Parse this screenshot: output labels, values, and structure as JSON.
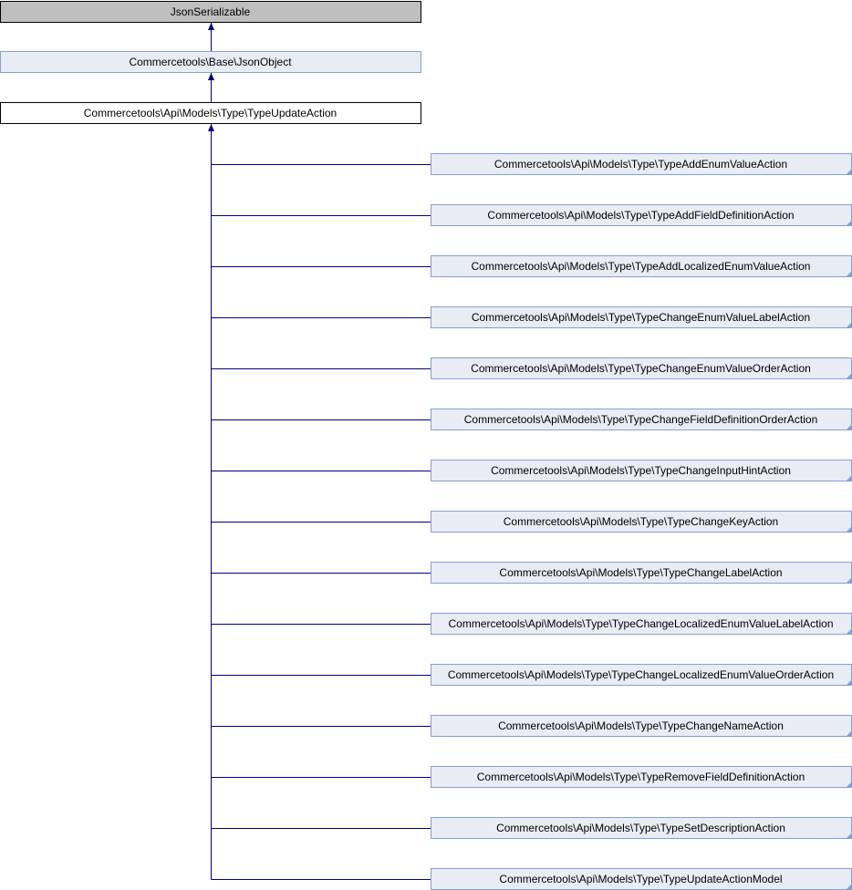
{
  "colors": {
    "edge": "#000080",
    "external_fill": "#bfbfbf",
    "class_fill": "#e8ecf5",
    "class_border": "#84a0d0",
    "current_fill": "#ffffff",
    "current_border": "#000000"
  },
  "ancestors": [
    {
      "label": "JsonSerializable",
      "kind": "external"
    },
    {
      "label": "Commercetools\\Base\\JsonObject",
      "kind": "class"
    },
    {
      "label": "Commercetools\\Api\\Models\\Type\\TypeUpdateAction",
      "kind": "current"
    }
  ],
  "children": [
    "Commercetools\\Api\\Models\\Type\\TypeAddEnumValueAction",
    "Commercetools\\Api\\Models\\Type\\TypeAddFieldDefinitionAction",
    "Commercetools\\Api\\Models\\Type\\TypeAddLocalizedEnumValueAction",
    "Commercetools\\Api\\Models\\Type\\TypeChangeEnumValueLabelAction",
    "Commercetools\\Api\\Models\\Type\\TypeChangeEnumValueOrderAction",
    "Commercetools\\Api\\Models\\Type\\TypeChangeFieldDefinitionOrderAction",
    "Commercetools\\Api\\Models\\Type\\TypeChangeInputHintAction",
    "Commercetools\\Api\\Models\\Type\\TypeChangeKeyAction",
    "Commercetools\\Api\\Models\\Type\\TypeChangeLabelAction",
    "Commercetools\\Api\\Models\\Type\\TypeChangeLocalizedEnumValueLabelAction",
    "Commercetools\\Api\\Models\\Type\\TypeChangeLocalizedEnumValueOrderAction",
    "Commercetools\\Api\\Models\\Type\\TypeChangeNameAction",
    "Commercetools\\Api\\Models\\Type\\TypeRemoveFieldDefinitionAction",
    "Commercetools\\Api\\Models\\Type\\TypeSetDescriptionAction",
    "Commercetools\\Api\\Models\\Type\\TypeUpdateActionModel"
  ]
}
